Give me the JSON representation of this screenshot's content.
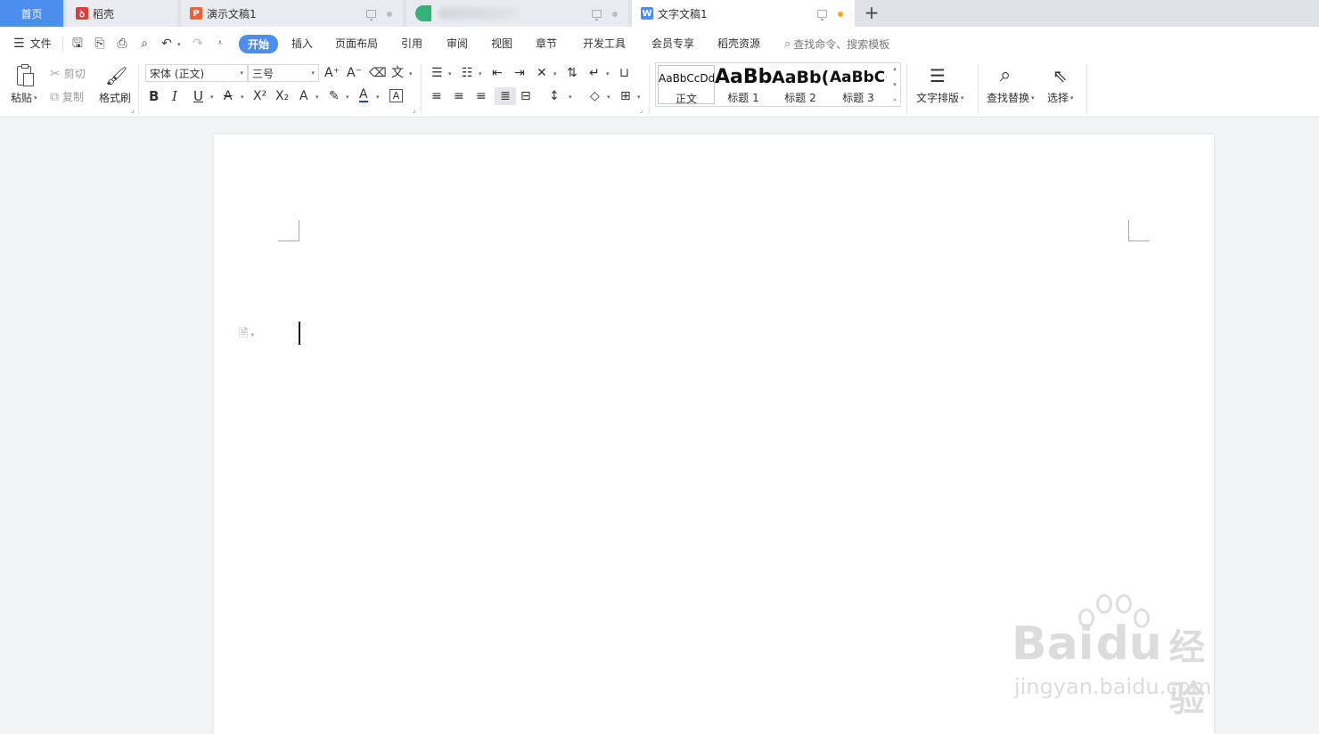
{
  "tabs": {
    "home": "首页",
    "daoke": "稻壳",
    "ppt": "演示文稿1",
    "doc": "文字文稿1"
  },
  "menu": {
    "file": "文件",
    "items": [
      "开始",
      "插入",
      "页面布局",
      "引用",
      "审阅",
      "视图",
      "章节",
      "开发工具",
      "会员专享",
      "稻壳资源"
    ],
    "search_placeholder": "查找命令、搜索模板"
  },
  "ribbon": {
    "paste": "粘贴",
    "cut": "剪切",
    "copy": "复制",
    "format_painter": "格式刷",
    "font_name": "宋体 (正文)",
    "font_size": "三号",
    "styles": [
      {
        "sample": "AaBbCcDd",
        "name": "正文"
      },
      {
        "sample": "AaBb",
        "name": "标题 1"
      },
      {
        "sample": "AaBb(",
        "name": "标题 2"
      },
      {
        "sample": "AaBbC(",
        "name": "标题 3"
      }
    ],
    "text_layout": "文字排版",
    "find_replace": "查找替换",
    "select": "选择"
  },
  "watermark": {
    "brand": "Bai",
    "brand2": "du",
    "brand_cn": "经验",
    "url": "jingyan.baidu.com"
  },
  "colors": {
    "accent": "#4d8dee",
    "modified_dot": "#f5a623",
    "ppt_icon": "#e8643a",
    "daoke_icon": "#e03a3a",
    "doc_icon": "#4d8dee"
  }
}
